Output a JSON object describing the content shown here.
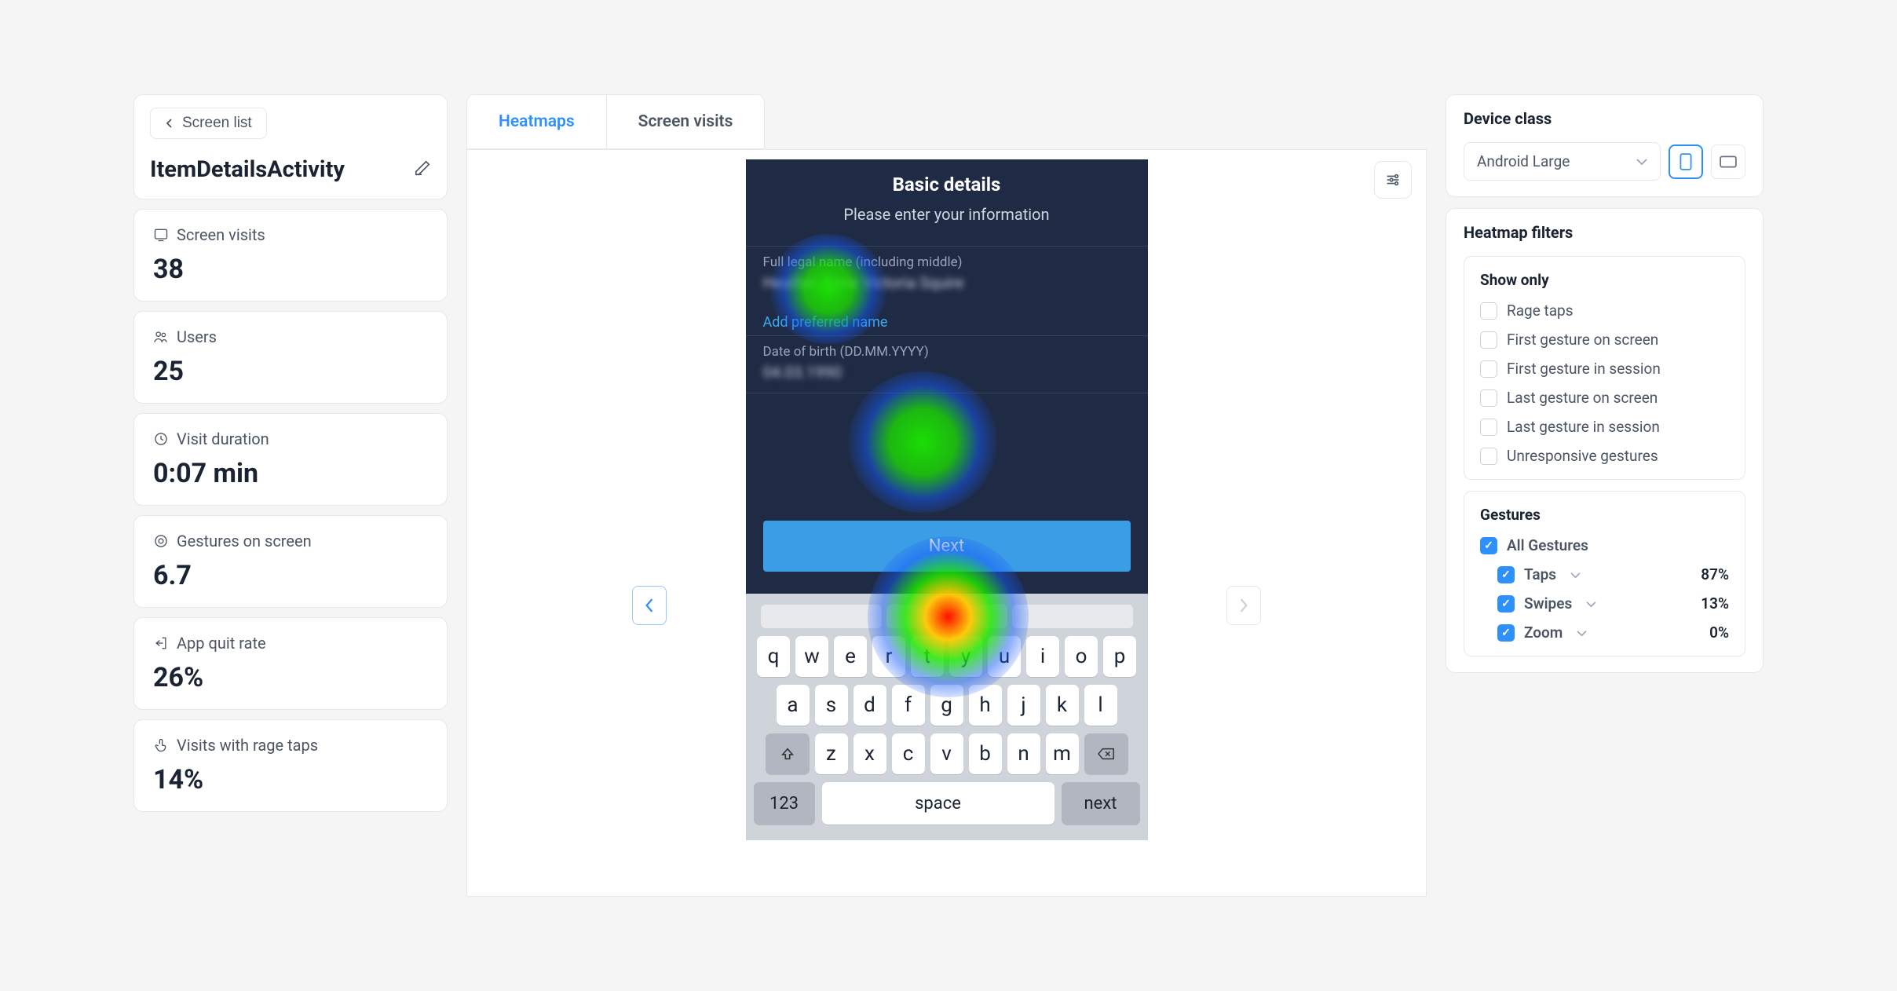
{
  "sidebar": {
    "back_label": "Screen list",
    "title": "ItemDetailsActivity",
    "stats": [
      {
        "label": "Screen visits",
        "value": "38"
      },
      {
        "label": "Users",
        "value": "25"
      },
      {
        "label": "Visit duration",
        "value": "0:07 min"
      },
      {
        "label": "Gestures on screen",
        "value": "6.7"
      },
      {
        "label": "App quit rate",
        "value": "26%"
      },
      {
        "label": "Visits with rage taps",
        "value": "14%"
      }
    ]
  },
  "tabs": {
    "heatmaps": "Heatmaps",
    "visits": "Screen visits"
  },
  "preview": {
    "title": "Basic details",
    "subtitle": "Please enter your information",
    "field1_label": "Full legal name (including middle)",
    "link_preferred": "Add preferred name",
    "field2_label": "Date of birth (DD.MM.YYYY)",
    "next": "Next",
    "keys_r1": [
      "q",
      "w",
      "e",
      "r",
      "t",
      "y",
      "u",
      "i",
      "o",
      "p"
    ],
    "keys_r2": [
      "a",
      "s",
      "d",
      "f",
      "g",
      "h",
      "j",
      "k",
      "l"
    ],
    "keys_r3": [
      "z",
      "x",
      "c",
      "v",
      "b",
      "n",
      "m"
    ],
    "num_label": "123",
    "space_label": "space",
    "next_key": "next"
  },
  "right": {
    "device_title": "Device class",
    "device_value": "Android Large",
    "filters_title": "Heatmap filters",
    "show_only": "Show only",
    "filter_items": [
      "Rage taps",
      "First gesture on screen",
      "First gesture in session",
      "Last gesture on screen",
      "Last gesture in session",
      "Unresponsive gestures"
    ],
    "gestures_title": "Gestures",
    "all_gestures": "All Gestures",
    "gesture_items": [
      {
        "label": "Taps",
        "pct": "87%"
      },
      {
        "label": "Swipes",
        "pct": "13%"
      },
      {
        "label": "Zoom",
        "pct": "0%"
      }
    ]
  }
}
